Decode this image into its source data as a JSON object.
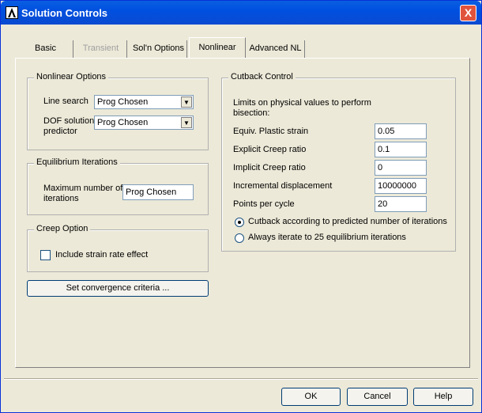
{
  "window": {
    "title": "Solution Controls",
    "close_label": "X"
  },
  "tabs": [
    {
      "label": "Basic",
      "state": "normal"
    },
    {
      "label": "Transient",
      "state": "disabled"
    },
    {
      "label": "Sol'n Options",
      "state": "normal"
    },
    {
      "label": "Nonlinear",
      "state": "active"
    },
    {
      "label": "Advanced NL",
      "state": "normal"
    }
  ],
  "nonlinear_options": {
    "title": "Nonlinear Options",
    "line_search_label": "Line search",
    "line_search_value": "Prog Chosen",
    "dof_label_1": "DOF solution",
    "dof_label_2": "predictor",
    "dof_value": "Prog Chosen"
  },
  "equilibrium": {
    "title": "Equilibrium Iterations",
    "max_label_1": "Maximum number of",
    "max_label_2": "iterations",
    "max_value": "Prog Chosen"
  },
  "creep": {
    "title": "Creep Option",
    "strain_rate_label": "Include strain rate effect",
    "strain_rate_checked": false
  },
  "convergence_button": "Set convergence criteria ...",
  "cutback": {
    "title": "Cutback Control",
    "intro_1": "Limits on physical values to perform",
    "intro_2": "bisection:",
    "fields": [
      {
        "label": "Equiv. Plastic strain",
        "value": "0.05"
      },
      {
        "label": "Explicit Creep ratio",
        "value": "0.1"
      },
      {
        "label": "Implicit Creep ratio",
        "value": "0"
      },
      {
        "label": "Incremental displacement",
        "value": "10000000"
      },
      {
        "label": "Points per cycle",
        "value": "20"
      }
    ],
    "radio_1": "Cutback according to predicted number of iterations",
    "radio_2": "Always iterate to 25 equilibrium iterations",
    "selected_radio": 1
  },
  "footer": {
    "ok": "OK",
    "cancel": "Cancel",
    "help": "Help"
  }
}
